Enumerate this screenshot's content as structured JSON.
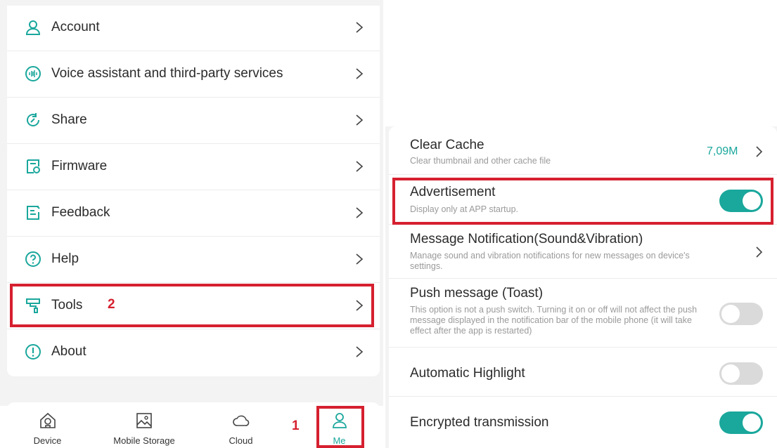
{
  "colors": {
    "accent": "#1aa79c",
    "highlight": "#d6202f"
  },
  "menu": {
    "items": [
      {
        "label": "Account",
        "icon": "person-icon"
      },
      {
        "label": "Voice assistant and third-party services",
        "icon": "voice-icon"
      },
      {
        "label": "Share",
        "icon": "share-icon"
      },
      {
        "label": "Firmware",
        "icon": "firmware-icon"
      },
      {
        "label": "Feedback",
        "icon": "feedback-icon"
      },
      {
        "label": "Help",
        "icon": "help-icon"
      },
      {
        "label": "Tools",
        "icon": "tools-icon"
      },
      {
        "label": "About",
        "icon": "about-icon"
      }
    ],
    "tools_step": "2"
  },
  "tabbar": {
    "tabs": [
      {
        "label": "Device",
        "icon": "device-icon"
      },
      {
        "label": "Mobile Storage",
        "icon": "image-icon"
      },
      {
        "label": "Cloud",
        "icon": "cloud-icon"
      },
      {
        "label": "Me",
        "icon": "person-icon",
        "active": true
      }
    ],
    "me_step": "1"
  },
  "settings": {
    "clear_cache": {
      "title": "Clear Cache",
      "desc": "Clear thumbnail and other cache file",
      "value": "7,09M"
    },
    "advertisement": {
      "title": "Advertisement",
      "desc": "Display only at APP startup.",
      "enabled": true
    },
    "message_notification": {
      "title": "Message Notification(Sound&Vibration)",
      "desc": "Manage sound and vibration notifications for new messages on device's settings."
    },
    "push_message": {
      "title": "Push message (Toast)",
      "desc": "This option is not a push switch. Turning it on or off will not affect the push message displayed in the notification bar of the mobile phone (it will take effect after the app is restarted)",
      "enabled": false
    },
    "automatic_highlight": {
      "title": "Automatic Highlight",
      "enabled": false
    },
    "encrypted_transmission": {
      "title": "Encrypted transmission",
      "enabled": true
    }
  }
}
